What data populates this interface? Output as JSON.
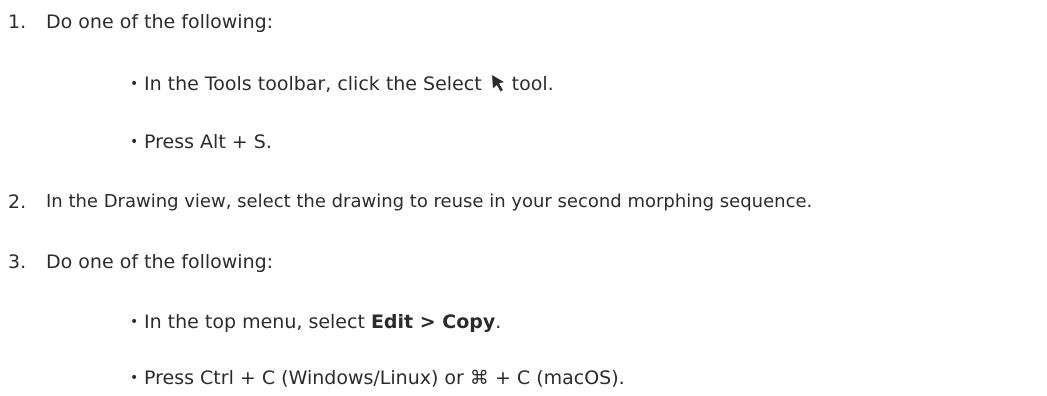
{
  "steps": [
    {
      "number": "1.",
      "text": "Do one of the following:",
      "bullets": [
        {
          "pre": "In the Tools toolbar, click the Select",
          "icon": "select-arrow-icon",
          "post": "tool."
        },
        {
          "text": "Press Alt + S."
        }
      ]
    },
    {
      "number": "2.",
      "text": "In the Drawing view, select the drawing to reuse in your second morphing sequence."
    },
    {
      "number": "3.",
      "text": "Do one of the following:",
      "bullets": [
        {
          "pre": "In the top menu, select ",
          "bold": "Edit > Copy",
          "post": "."
        },
        {
          "text": "Press Ctrl + C (Windows/Linux) or ⌘ + C (macOS)."
        }
      ]
    }
  ],
  "bullet_glyph": "•"
}
